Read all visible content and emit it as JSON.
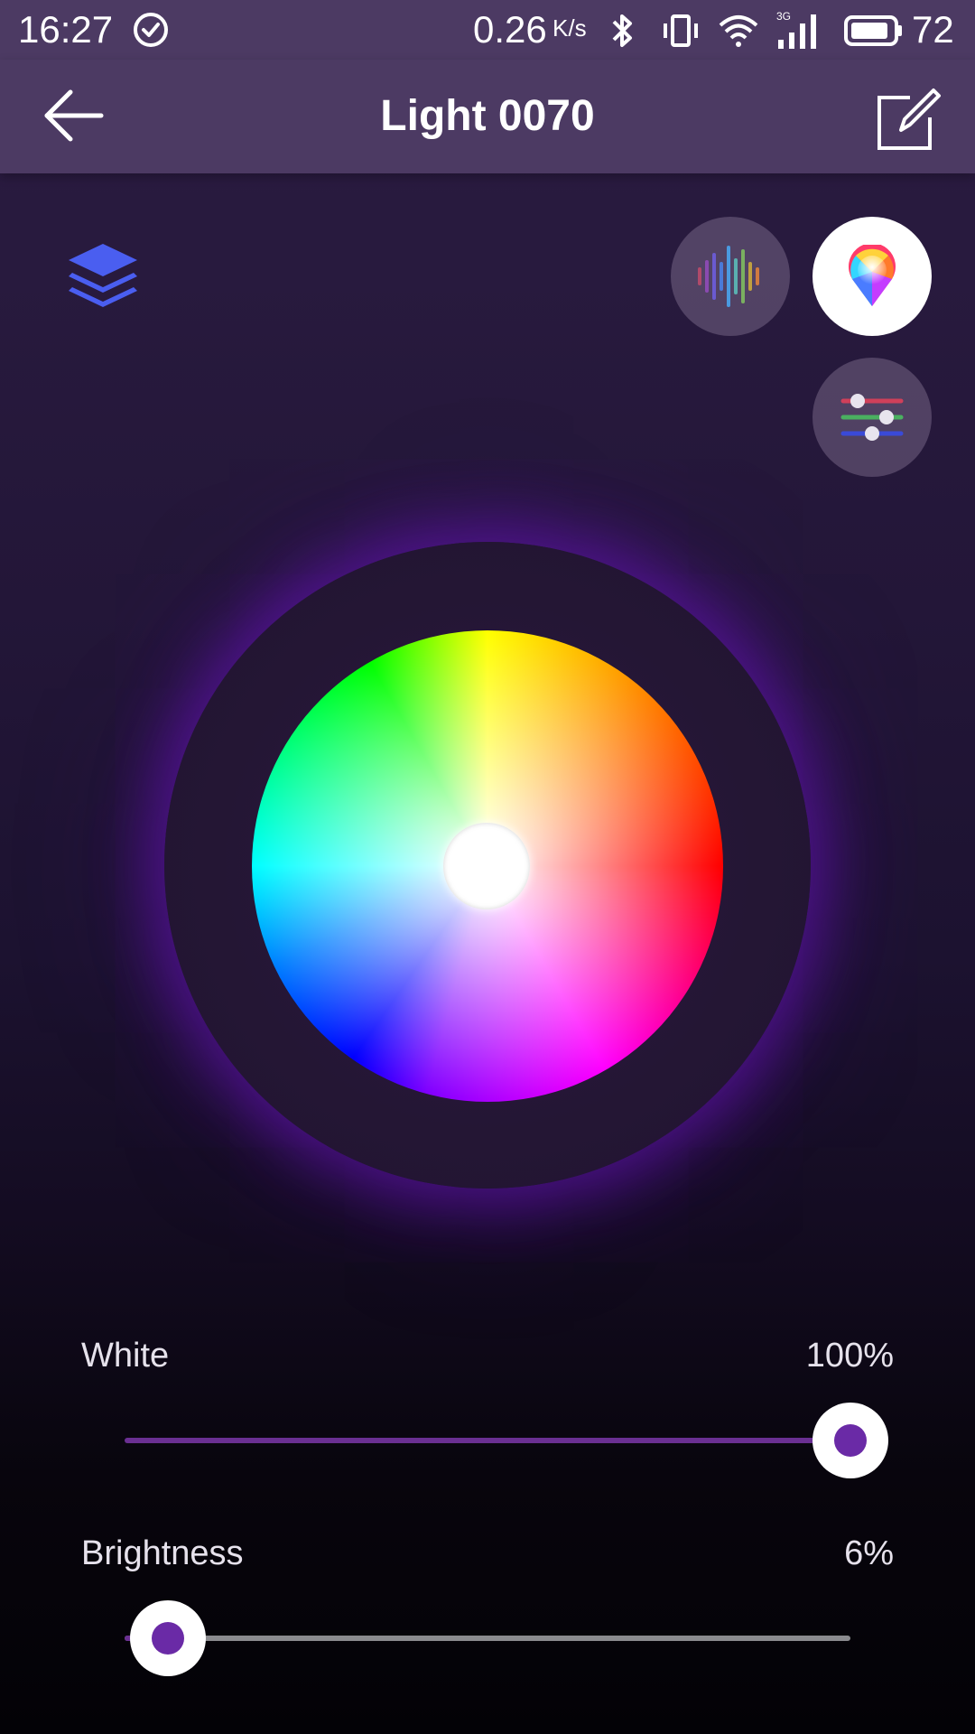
{
  "status_bar": {
    "time": "16:27",
    "net_speed": "0.26",
    "net_speed_unit": "K/s",
    "network_type": "3G",
    "battery_percent": "72"
  },
  "app_bar": {
    "title": "Light 0070",
    "back_icon": "arrow-left-icon",
    "edit_icon": "edit-icon"
  },
  "modes": {
    "scenes_icon": "layers-icon",
    "music_icon": "sound-wave-icon",
    "color_icon": "color-drop-icon",
    "rgb_icon": "rgb-sliders-icon",
    "selected": "color"
  },
  "color_wheel": {
    "selected_color": "#ffffff"
  },
  "sliders": {
    "white": {
      "label": "White",
      "value_text": "100%",
      "value": 1.0
    },
    "brightness": {
      "label": "Brightness",
      "value_text": "6%",
      "value": 0.06
    }
  },
  "colors": {
    "app_bar": "#4c3a63",
    "accent": "#6a2aa6",
    "track_inactive": "#8a8a8e"
  }
}
